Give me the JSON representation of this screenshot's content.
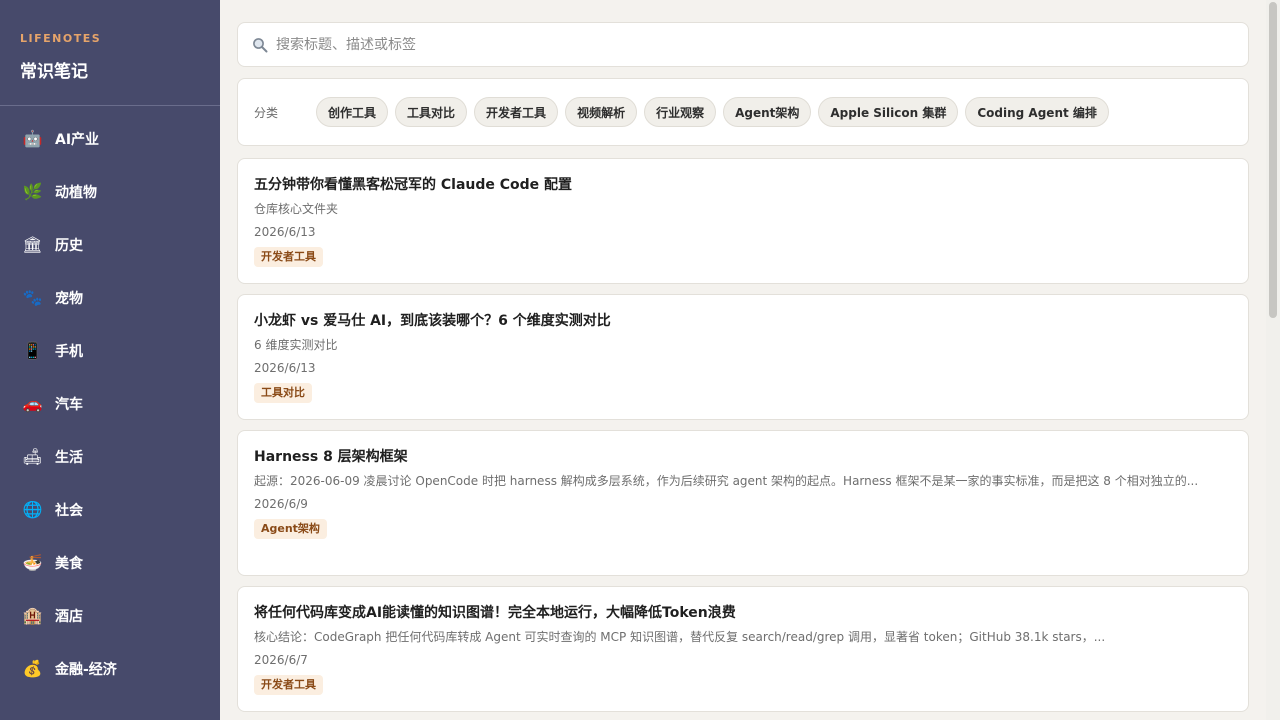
{
  "brand": {
    "small": "LIFENOTES",
    "title": "常识笔记"
  },
  "sidebar": {
    "items": [
      {
        "icon": "🤖",
        "icon_name": "robot-icon",
        "label": "AI产业"
      },
      {
        "icon": "🌿",
        "icon_name": "herb-icon",
        "label": "动植物"
      },
      {
        "icon": "🏛",
        "icon_name": "classical-building-icon",
        "label": "历史"
      },
      {
        "icon": "🐾",
        "icon_name": "paw-prints-icon",
        "label": "宠物"
      },
      {
        "icon": "📱",
        "icon_name": "mobile-phone-icon",
        "label": "手机"
      },
      {
        "icon": "🚗",
        "icon_name": "car-icon",
        "label": "汽车"
      },
      {
        "icon": "🛋",
        "icon_name": "couch-icon",
        "label": "生活"
      },
      {
        "icon": "🌐",
        "icon_name": "globe-icon",
        "label": "社会"
      },
      {
        "icon": "🍜",
        "icon_name": "noodle-bowl-icon",
        "label": "美食"
      },
      {
        "icon": "🏨",
        "icon_name": "hotel-icon",
        "label": "酒店"
      },
      {
        "icon": "💰",
        "icon_name": "money-bag-icon",
        "label": "金融-经济"
      }
    ]
  },
  "search": {
    "placeholder": "搜索标题、描述或标签",
    "value": ""
  },
  "filter": {
    "label": "分类",
    "chips": [
      "创作工具",
      "工具对比",
      "开发者工具",
      "视频解析",
      "行业观察",
      "Agent架构",
      "Apple Silicon 集群",
      "Coding Agent 编排"
    ]
  },
  "cards": [
    {
      "title": "五分钟带你看懂黑客松冠军的 Claude Code 配置",
      "desc": "仓库核心文件夹",
      "date": "2026/6/13",
      "tag": "开发者工具"
    },
    {
      "title": "小龙虾 vs 爱马仕 AI，到底该装哪个？6 个维度实测对比",
      "desc": "6 维度实测对比",
      "date": "2026/6/13",
      "tag": "工具对比"
    },
    {
      "title": "Harness 8 层架构框架",
      "desc": "起源：2026-06-09 凌晨讨论 OpenCode 时把 harness 解构成多层系统，作为后续研究 agent 架构的起点。Harness 框架不是某一家的事实标准，而是把这 8 个相对独立的...",
      "date": "2026/6/9",
      "tag": "Agent架构"
    },
    {
      "title": "将任何代码库变成AI能读懂的知识图谱！完全本地运行，大幅降低Token浪费",
      "desc": "核心结论：CodeGraph 把任何代码库转成 Agent 可实时查询的 MCP 知识图谱，替代反复 search/read/grep 调用，显著省 token；GitHub 38.1k stars，...",
      "date": "2026/6/7",
      "tag": "开发者工具"
    }
  ]
}
